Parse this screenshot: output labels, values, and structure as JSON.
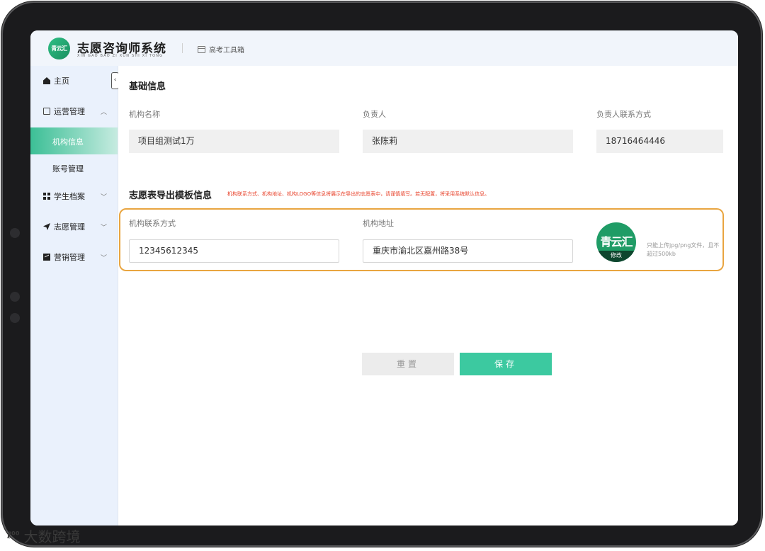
{
  "header": {
    "logo_text": "青云汇",
    "title": "志愿咨询师系统",
    "subtitle": "XIN GAO BAO ZI XUN SHI XI TONG",
    "tool_link": "高考工具箱"
  },
  "sidebar": {
    "collapse_glyph": "‹",
    "items": [
      {
        "label": "主页",
        "icon": "home-icon"
      },
      {
        "label": "运营管理",
        "icon": "bag-icon",
        "chevron": "︿"
      },
      {
        "label": "机构信息",
        "active": true
      },
      {
        "label": "账号管理"
      },
      {
        "label": "学生档案",
        "icon": "grid-icon",
        "chevron": "﹀"
      },
      {
        "label": "志愿管理",
        "icon": "send-icon",
        "chevron": "﹀"
      },
      {
        "label": "营销管理",
        "icon": "chart-icon",
        "chevron": "﹀"
      }
    ]
  },
  "basic_info": {
    "title": "基础信息",
    "org_name_label": "机构名称",
    "org_name_value": "项目组测试1万",
    "owner_label": "负责人",
    "owner_value": "张陈莉",
    "owner_contact_label": "负责人联系方式",
    "owner_contact_value": "18716464446"
  },
  "export_template": {
    "title": "志愿表导出模板信息",
    "hint": "机构联系方式、机构地址、机构LOGO等信息将展示在导出的志愿表中，请谨慎填写。若无配置，将采用系统默认信息。",
    "contact_label": "机构联系方式",
    "contact_value": "12345612345",
    "address_label": "机构地址",
    "address_value": "重庆市渝北区嘉州路38号",
    "logo_text": "青云汇",
    "logo_edit": "修改",
    "upload_hint": "只能上传jpg/png文件，且不超过500kb"
  },
  "actions": {
    "reset_label": "重置",
    "save_label": "保存"
  },
  "watermark": {
    "mark": "ℓ⁰⁰",
    "text": "大数跨境"
  },
  "colors": {
    "accent": "#3cc9a0",
    "frame": "#e9a540",
    "hint_red": "#e8462f"
  }
}
